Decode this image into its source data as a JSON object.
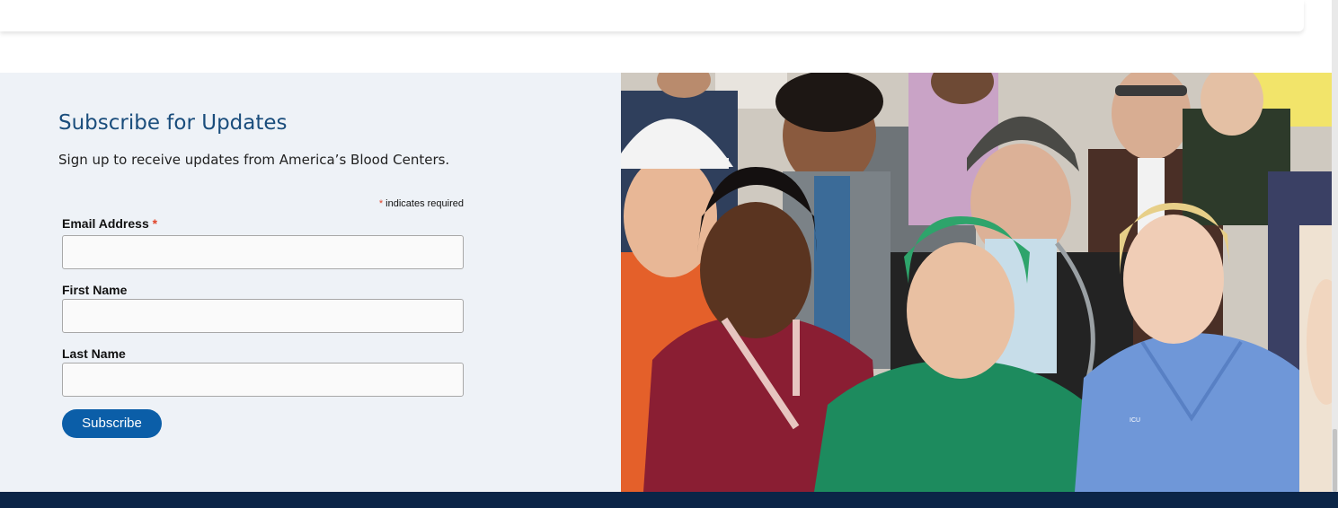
{
  "subscribe": {
    "heading": "Subscribe for Updates",
    "description": "Sign up to receive updates from America’s Blood Centers.",
    "required_marker": "*",
    "required_note": "indicates required",
    "fields": [
      {
        "label": "Email Address",
        "required": true,
        "value": ""
      },
      {
        "label": "First Name",
        "required": false,
        "value": ""
      },
      {
        "label": "Last Name",
        "required": false,
        "value": ""
      }
    ],
    "button_label": "Subscribe"
  },
  "photo": {
    "badge_text": "ICU"
  },
  "colors": {
    "heading": "#1a4d7c",
    "panel_bg": "#eef2f7",
    "button": "#0b5ea8",
    "footer": "#0b2547",
    "required": "#e0442a"
  }
}
